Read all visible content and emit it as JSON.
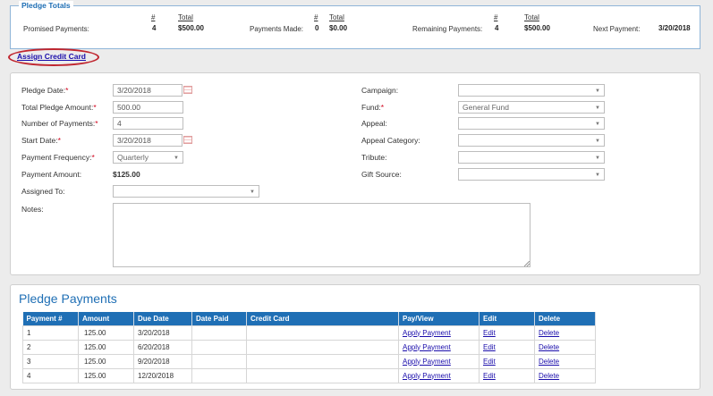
{
  "totals": {
    "legend": "Pledge Totals",
    "hash": "#",
    "total": "Total",
    "promised_label": "Promised Payments:",
    "promised_count": "4",
    "promised_total": "$500.00",
    "made_label": "Payments Made:",
    "made_count": "0",
    "made_total": "$0.00",
    "remaining_label": "Remaining Payments:",
    "remaining_count": "4",
    "remaining_total": "$500.00",
    "next_label": "Next Payment:",
    "next_date": "3/20/2018"
  },
  "assign_credit_card": "Assign Credit Card",
  "form": {
    "pledge_date_label": "Pledge Date:",
    "pledge_date": "3/20/2018",
    "total_amount_label": "Total Pledge Amount:",
    "total_amount": "500.00",
    "num_payments_label": "Number of Payments:",
    "num_payments": "4",
    "start_date_label": "Start Date:",
    "start_date": "3/20/2018",
    "frequency_label": "Payment Frequency:",
    "frequency": "Quarterly",
    "payment_amount_label": "Payment Amount:",
    "payment_amount": "$125.00",
    "assigned_to_label": "Assigned To:",
    "assigned_to": "",
    "notes_label": "Notes:",
    "notes": "",
    "campaign_label": "Campaign:",
    "campaign": "",
    "fund_label": "Fund:",
    "fund": "General Fund",
    "appeal_label": "Appeal:",
    "appeal": "",
    "appeal_category_label": "Appeal Category:",
    "appeal_category": "",
    "tribute_label": "Tribute:",
    "tribute": "",
    "gift_source_label": "Gift Source:",
    "gift_source": "",
    "required_mark": "*"
  },
  "payments": {
    "title": "Pledge Payments",
    "columns": [
      "Payment #",
      "Amount",
      "Due Date",
      "Date Paid",
      "Credit Card",
      "Pay/View",
      "Edit",
      "Delete"
    ],
    "rows": [
      {
        "num": "1",
        "amount": "125.00",
        "due": "3/20/2018",
        "paid": "",
        "card": "",
        "pay": "Apply Payment",
        "edit": "Edit",
        "delete": "Delete"
      },
      {
        "num": "2",
        "amount": "125.00",
        "due": "6/20/2018",
        "paid": "",
        "card": "",
        "pay": "Apply Payment",
        "edit": "Edit",
        "delete": "Delete"
      },
      {
        "num": "3",
        "amount": "125.00",
        "due": "9/20/2018",
        "paid": "",
        "card": "",
        "pay": "Apply Payment",
        "edit": "Edit",
        "delete": "Delete"
      },
      {
        "num": "4",
        "amount": "125.00",
        "due": "12/20/2018",
        "paid": "",
        "card": "",
        "pay": "Apply Payment",
        "edit": "Edit",
        "delete": "Delete"
      }
    ]
  },
  "icons": {
    "calendar": "calendar-icon",
    "dropdown": "chevron-down-icon"
  }
}
